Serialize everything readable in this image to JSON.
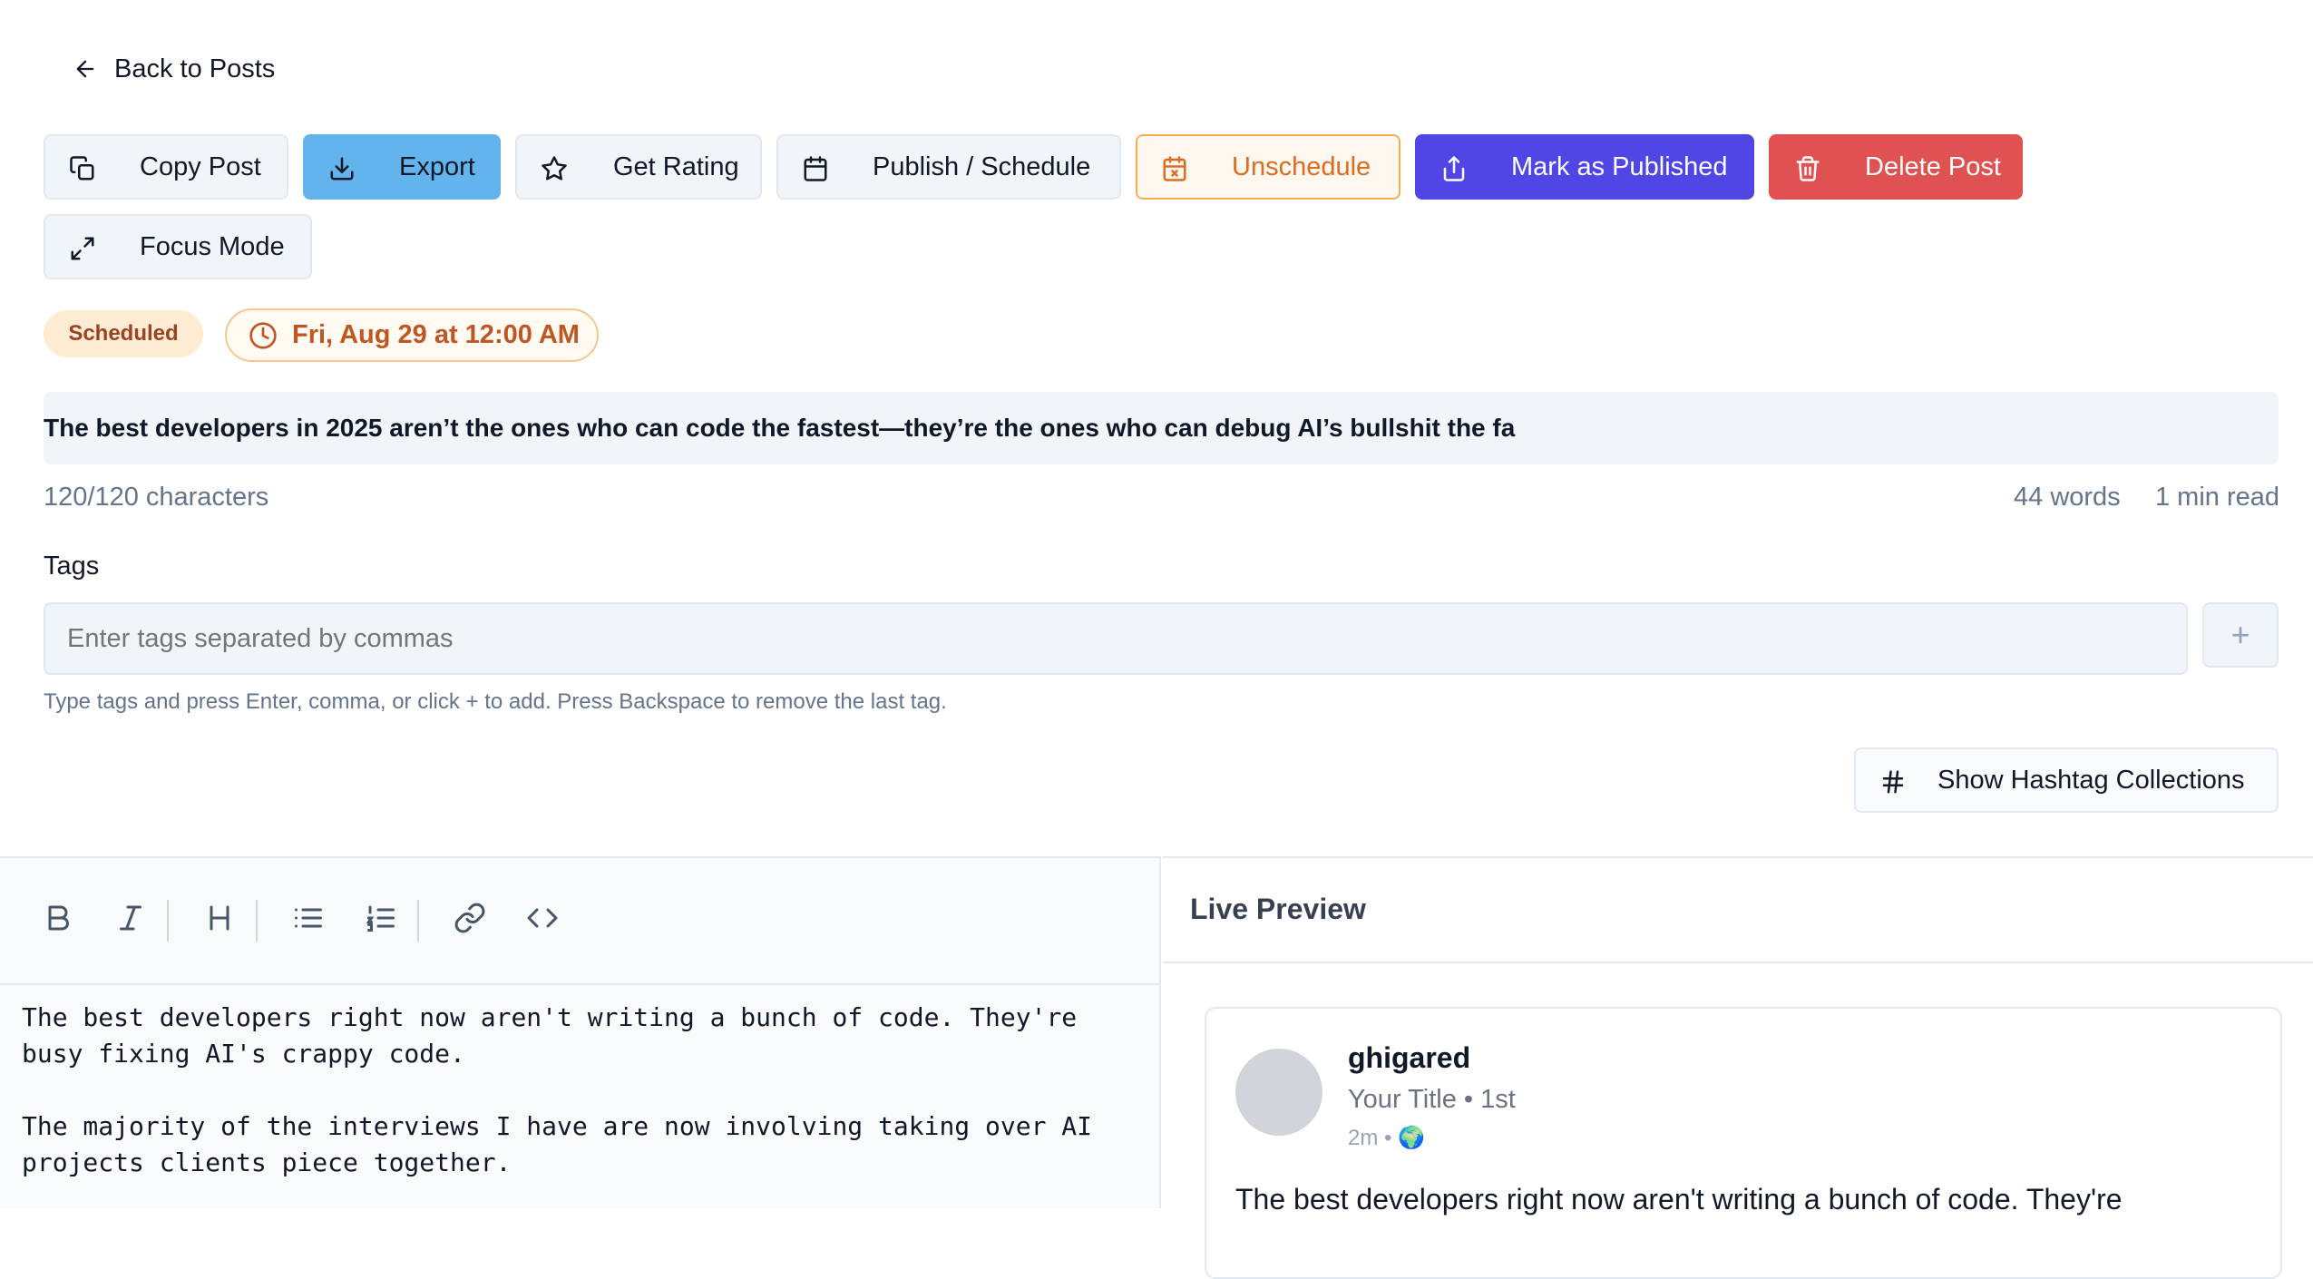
{
  "nav": {
    "back_label": "Back to Posts"
  },
  "toolbar": {
    "copy": "Copy Post",
    "export": "Export",
    "rating": "Get Rating",
    "publish": "Publish / Schedule",
    "unschedule": "Unschedule",
    "mark_published": "Mark as Published",
    "delete": "Delete Post",
    "focus": "Focus Mode"
  },
  "status": {
    "badge": "Scheduled",
    "scheduled_for": "Fri, Aug 29 at 12:00 AM"
  },
  "post": {
    "title": "The best developers in 2025 aren’t the ones who can code the fastest—they’re the ones who can debug AI’s bullshit the fa",
    "char_count": "120/120 characters",
    "word_count": "44 words",
    "read_time": "1 min read"
  },
  "tags": {
    "label": "Tags",
    "placeholder": "Enter tags separated by commas",
    "add_symbol": "+",
    "help": "Type tags and press Enter, comma, or click + to add. Press Backspace to remove the last tag."
  },
  "hashtags": {
    "button_label": "Show Hashtag Collections"
  },
  "editor": {
    "content": "The best developers right now aren't writing a bunch of code. They're\nbusy fixing AI's crappy code.\n\nThe majority of the interviews I have are now involving taking over AI\nprojects clients piece together.",
    "tools": [
      "bold-icon",
      "italic-icon",
      "heading-icon",
      "bullet-list-icon",
      "numbered-list-icon",
      "link-icon",
      "code-icon"
    ]
  },
  "preview": {
    "heading": "Live Preview",
    "author": "ghigared",
    "subtitle": "Your Title • 1st",
    "time": "2m • 🌍",
    "text": "The best developers right now aren't writing a bunch of code. They're"
  },
  "colors": {
    "export": "#63b3ed",
    "unschedule": "#dd6b20",
    "mark_published": "#4f46e5",
    "delete": "#e05252",
    "scheduled_badge": "#feebd4"
  }
}
